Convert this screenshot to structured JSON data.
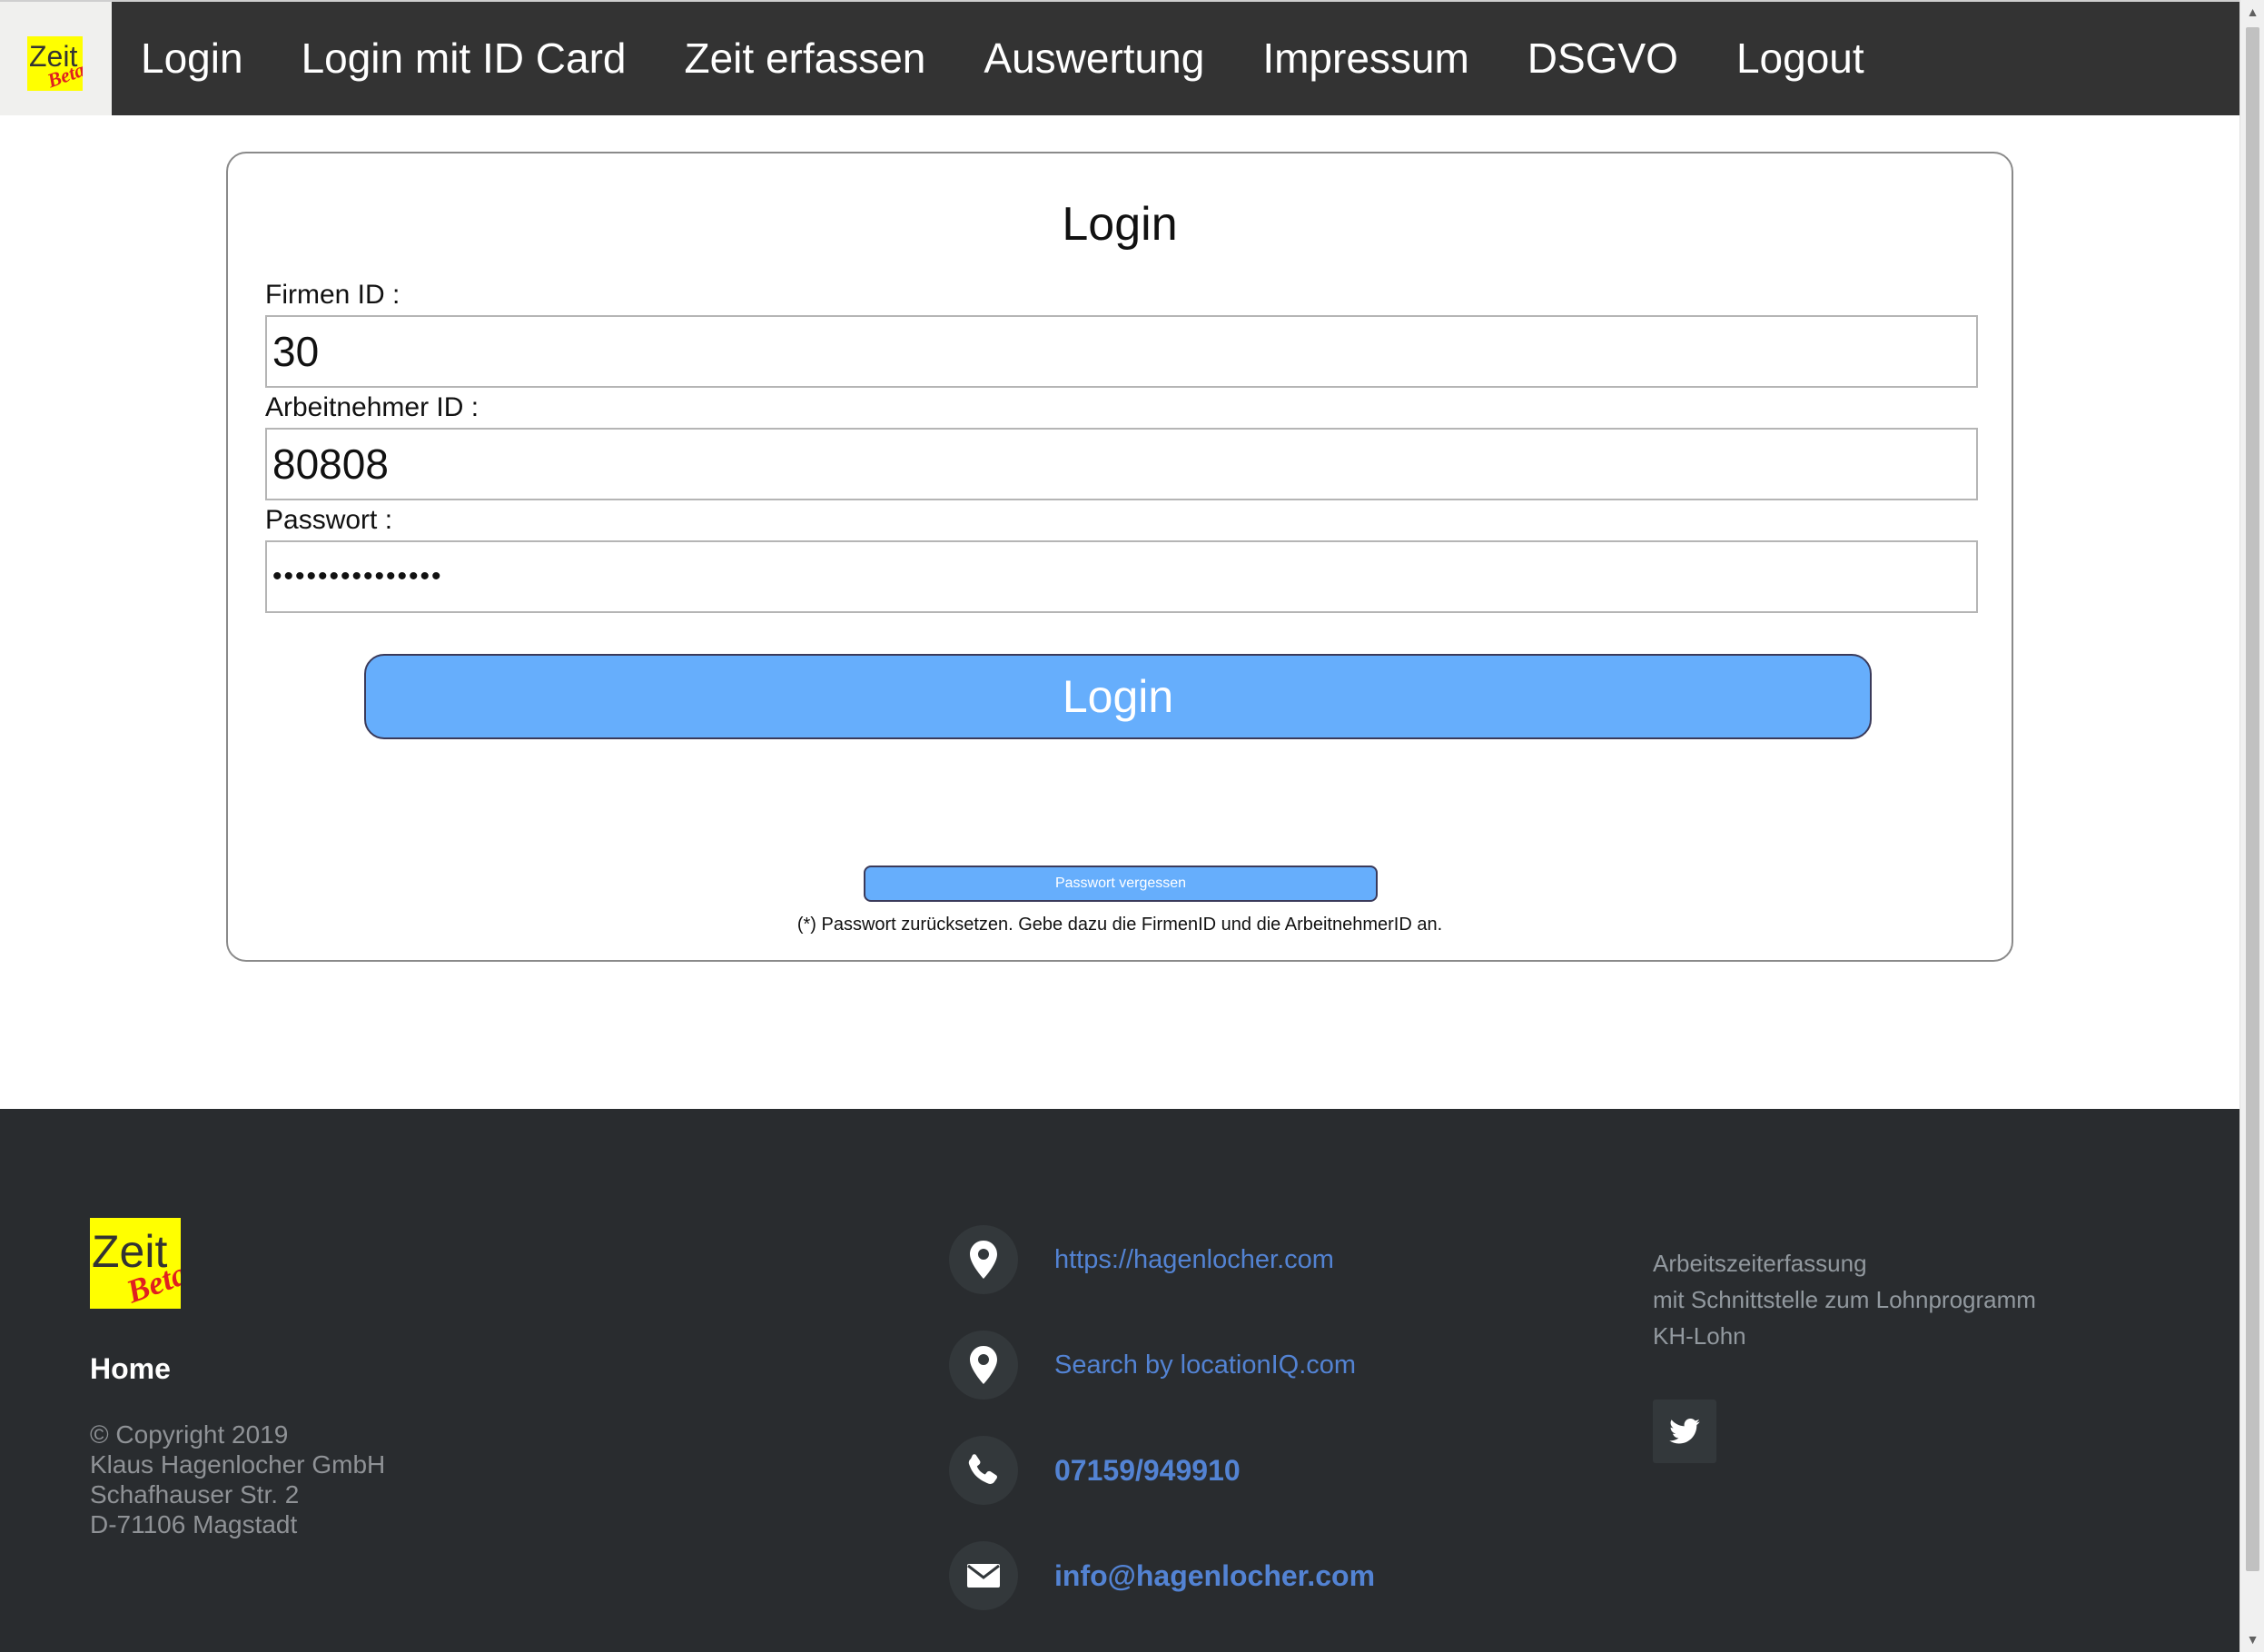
{
  "nav": {
    "logo": {
      "text": "Zeit",
      "badge": "Beta"
    },
    "items": [
      {
        "label": "Login"
      },
      {
        "label": "Login mit ID Card"
      },
      {
        "label": "Zeit erfassen"
      },
      {
        "label": "Auswertung"
      },
      {
        "label": "Impressum"
      },
      {
        "label": "DSGVO"
      },
      {
        "label": "Logout"
      }
    ]
  },
  "login": {
    "title": "Login",
    "firmen_label": "Firmen ID :",
    "firmen_value": "30",
    "arbeitnehmer_label": "Arbeitnehmer ID :",
    "arbeitnehmer_value": "80808",
    "passwort_label": "Passwort :",
    "passwort_value": "•••••••••••••••",
    "login_button": "Login",
    "forgot_button": "Passwort vergessen",
    "reset_hint": "(*) Passwort zurücksetzen. Gebe dazu die FirmenID und die ArbeitnehmerID an."
  },
  "footer": {
    "logo": {
      "text": "Zeit",
      "badge": "Beta"
    },
    "home": "Home",
    "address": {
      "line1": "© Copyright 2019",
      "line2": "Klaus Hagenlocher GmbH",
      "line3": "Schafhauser Str. 2",
      "line4": "D-71106 Magstadt"
    },
    "contacts": [
      {
        "icon": "location-pin-icon",
        "text": "https://hagenlocher.com"
      },
      {
        "icon": "location-pin-icon",
        "text": "Search by locationIQ.com"
      },
      {
        "icon": "phone-icon",
        "text": "07159/949910"
      },
      {
        "icon": "envelope-icon",
        "text": "info@hagenlocher.com"
      }
    ],
    "about": {
      "line1": "Arbeitszeiterfassung",
      "line2": "mit Schnittstelle zum Lohnprogramm",
      "line3": "KH-Lohn"
    },
    "social_icon": "twitter-icon"
  },
  "colors": {
    "nav_bg": "#333333",
    "button_blue": "#66aefc",
    "footer_bg": "#292c2f",
    "link_blue": "#5383d3",
    "logo_yellow": "#ffff00",
    "logo_red": "#e02020"
  }
}
